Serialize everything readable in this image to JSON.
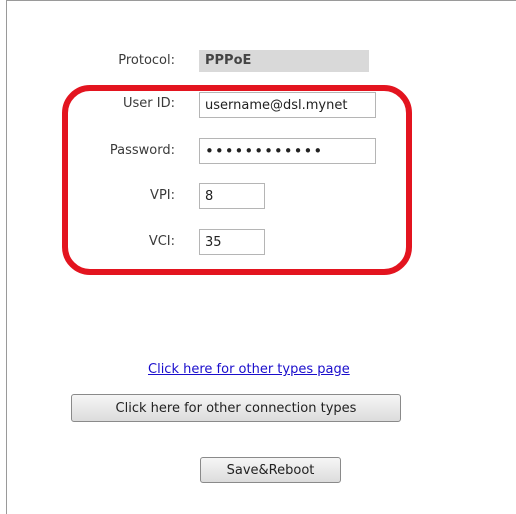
{
  "form": {
    "protocol_label": "Protocol:",
    "protocol_value": "PPPoE",
    "user_id_label": "User ID:",
    "user_id_value": "username@dsl.mynet",
    "password_label": "Password:",
    "password_value": "••••••••••••",
    "vpi_label": "VPI:",
    "vpi_value": "8",
    "vci_label": "VCI:",
    "vci_value": "35"
  },
  "links": {
    "other_types": "Click here for other types page"
  },
  "buttons": {
    "other_connection_types": "Click here for other connection types",
    "save_reboot": "Save&Reboot"
  },
  "colors": {
    "highlight": "#e3141f",
    "link": "#1a0dcc"
  }
}
